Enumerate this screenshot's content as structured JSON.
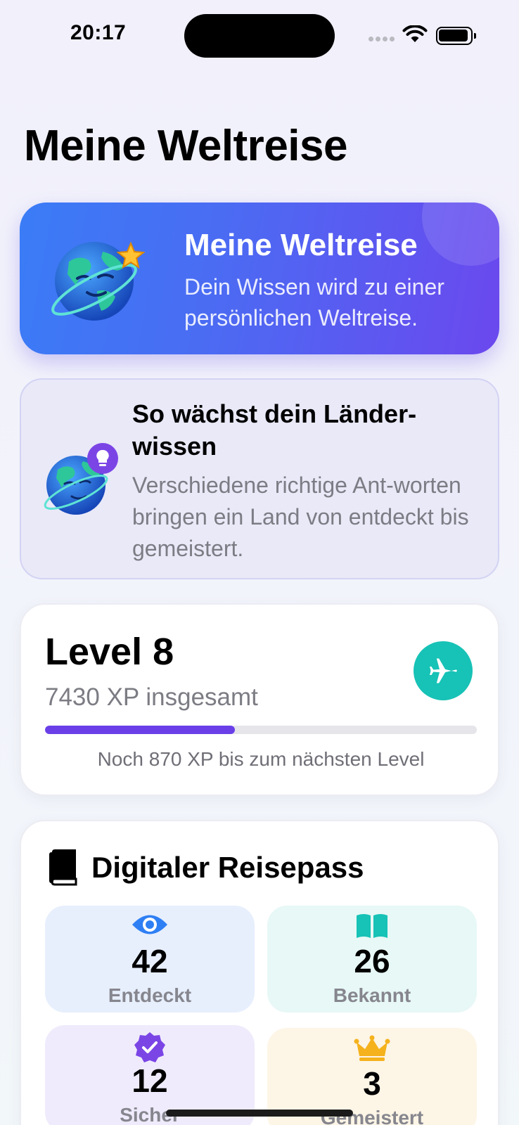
{
  "status_bar": {
    "time": "20:17"
  },
  "page": {
    "title": "Meine Weltreise"
  },
  "hero": {
    "title": "Meine Weltreise",
    "subtitle": "Dein Wissen wird zu einer persönlichen Weltreise."
  },
  "tip": {
    "title": "So wächst dein Länder-wissen",
    "text": "Verschiedene richtige Ant-worten bringen ein Land von entdeckt bis gemeistert."
  },
  "level": {
    "title": "Level 8",
    "xp_total": "7430 XP insgesamt",
    "progress_fraction": 0.44,
    "remaining": "Noch 870 XP bis zum nächsten Level",
    "accent_color": "#6a3fe8",
    "plane_icon": "airplane-icon"
  },
  "passport": {
    "title": "Digitaler Reisepass",
    "icon": "book-icon",
    "stats": [
      {
        "value": "42",
        "label": "Entdeckt",
        "icon": "eye-icon",
        "color": "#2f7ff4"
      },
      {
        "value": "26",
        "label": "Bekannt",
        "icon": "open-book-icon",
        "color": "#17c2b6"
      },
      {
        "value": "12",
        "label": "Sicher",
        "icon": "check-badge-icon",
        "color": "#7b45e6"
      },
      {
        "value": "3",
        "label": "Gemeistert",
        "icon": "crown-icon",
        "color": "#f5b21d"
      }
    ]
  }
}
